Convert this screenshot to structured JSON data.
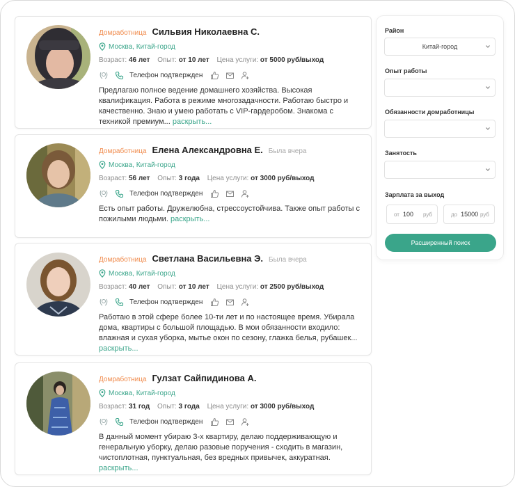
{
  "cards": [
    {
      "role": "Домработница",
      "name": "Сильвия Николаевна С.",
      "seen": "",
      "location": "Москва, Китай-город",
      "age_label": "Возраст:",
      "age": "46 лет",
      "exp_label": "Опыт:",
      "exp": "от 10 лет",
      "price_label": "Цена услуги:",
      "price": "от 5000 руб/выход",
      "phone": "Телефон подтвержден",
      "description": "Предлагаю полное ведение домашнего хозяйства. Высокая квалификация. Работа в режиме многозадачности. Работаю быстро и качественно. Знаю и умею работать с VIP-гардеробом. Знакома с техникой премиум...",
      "more": "раскрыть..."
    },
    {
      "role": "Домработница",
      "name": "Елена Александровна Е.",
      "seen": "Была вчера",
      "location": "Москва, Китай-город",
      "age_label": "Возраст:",
      "age": "56 лет",
      "exp_label": "Опыт:",
      "exp": "3 года",
      "price_label": "Цена услуги:",
      "price": "от 3000 руб/выход",
      "phone": "Телефон подтвержден",
      "description": "Есть опыт работы. Дружелюбна, стрессоустойчива. Также опыт работы с пожилыми людьми.",
      "more": "раскрыть..."
    },
    {
      "role": "Домработница",
      "name": "Светлана Васильевна Э.",
      "seen": "Была вчера",
      "location": "Москва, Китай-город",
      "age_label": "Возраст:",
      "age": "40 лет",
      "exp_label": "Опыт:",
      "exp": "от 10 лет",
      "price_label": "Цена услуги:",
      "price": "от 2500 руб/выход",
      "phone": "Телефон подтвержден",
      "description": "Работаю в этой сфере более 10-ти лет и по настоящее время. Убирала дома, квартиры с большой площадью. В мои обязанности входило: влажная и сухая уборка, мытье окон по сезону, глажка белья, рубашек...",
      "more": "раскрыть..."
    },
    {
      "role": "Домработница",
      "name": "Гулзат Сайпидинова А.",
      "seen": "",
      "location": "Москва, Китай-город",
      "age_label": "Возраст:",
      "age": "31 год",
      "exp_label": "Опыт:",
      "exp": "3 года",
      "price_label": "Цена услуги:",
      "price": "от 3000 руб/выход",
      "phone": "Телефон подтвержден",
      "description": "В данный момент убираю 3-х квартиру, делаю поддерживающую и генеральную уборку, делаю разовые поручения - сходить в магазин, чистоплотная, пунктуальная, без вредных привычек, аккуратная.",
      "more": "раскрыть..."
    }
  ],
  "filters": {
    "district_label": "Район",
    "district_value": "Китай-город",
    "experience_label": "Опыт работы",
    "experience_value": "",
    "duties_label": "Обязанности домработницы",
    "duties_value": "",
    "employment_label": "Занятость",
    "employment_value": "",
    "salary_label": "Зарплата за выход",
    "from_prefix": "от",
    "from_value": "100",
    "to_prefix": "до",
    "to_value": "15000",
    "currency": "руб",
    "search_button": "Расширенный поиск"
  },
  "icons": [
    "map-pin-icon",
    "laurel-badge-icon",
    "phone-icon",
    "thumbs-up-icon",
    "envelope-icon",
    "user-add-icon",
    "chevron-down-icon"
  ],
  "colors": {
    "accent": "#3aa58a",
    "role": "#f08a4b"
  }
}
